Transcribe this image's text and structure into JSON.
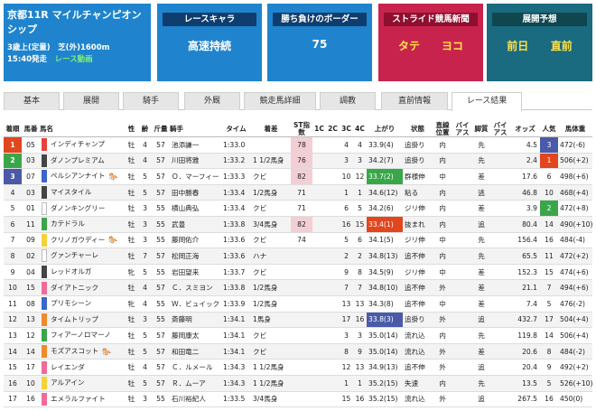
{
  "race": {
    "title": "京都11R マイルチャンピオンシップ",
    "conditions": "3歳上(定量)　芝(外)1600m",
    "post_time": "15:40発走",
    "video_link": "レース動画"
  },
  "cards": {
    "chara": {
      "title": "レースキャラ",
      "value": "高速持続"
    },
    "border": {
      "title": "勝ち負けのボーダー",
      "value": "75"
    },
    "shimbun": {
      "title": "ストライド競馬新聞",
      "left": "タテ",
      "right": "ヨコ"
    },
    "tenkai": {
      "title": "展開予想",
      "left": "前日",
      "right": "直前"
    }
  },
  "tabs": [
    "基本",
    "展開",
    "騎手",
    "外厩",
    "競走馬詳細",
    "調教",
    "直前情報",
    "レース結果"
  ],
  "active_tab": "レース結果",
  "headers": [
    "着順",
    "馬番",
    "馬名",
    "性",
    "齢",
    "斤量",
    "騎手",
    "タイム",
    "着差",
    "ST指数",
    "1C",
    "2C",
    "3C",
    "4C",
    "上がり",
    "状態",
    "直線位置",
    "バイアス",
    "脚質",
    "バイアス",
    "オッズ",
    "人気",
    "馬体重"
  ],
  "colors": {
    "gate_1": "#ffffff",
    "gate_2": "#444444",
    "gate_3": "#e8403a",
    "gate_4": "#3a67c8",
    "gate_5": "#f3d23a",
    "gate_6": "#3aa64a",
    "gate_7": "#f08a2a",
    "gate_8": "#f06a9a",
    "rank_1": "#e2461f",
    "rank_2": "#3aa64a",
    "rank_3": "#4a5aa8",
    "st_highlight": "#f3cfd5",
    "agari_1": "#e2461f",
    "agari_2": "#3aa64a",
    "agari_3": "#4a5aa8"
  },
  "rows": [
    {
      "rank": "1",
      "num": "05",
      "name": "インディチャンプ",
      "gate": 3,
      "flag": "",
      "sex": "牡",
      "age": "4",
      "kin": "57",
      "jockey": "池添謙一",
      "time": "1:33.0",
      "diff": "",
      "st": "78",
      "c1": "",
      "c2": "",
      "c3": "4",
      "c4": "4",
      "agari": "33.9(4)",
      "state": "追掛り",
      "pos": "内",
      "bias": "",
      "kyaku": "先",
      "bias2": "",
      "odds": "4.5",
      "ninki": "3",
      "weight": "472(-6)",
      "st_hl": true,
      "agari_rank": 0,
      "ninki_rank": 3
    },
    {
      "rank": "2",
      "num": "03",
      "name": "ダノンプレミアム",
      "gate": 2,
      "flag": "",
      "sex": "牡",
      "age": "4",
      "kin": "57",
      "jockey": "川田将雅",
      "time": "1:33.2",
      "diff": "1 1/2馬身",
      "st": "76",
      "c1": "",
      "c2": "",
      "c3": "3",
      "c4": "3",
      "agari": "34.2(7)",
      "state": "追掛り",
      "pos": "内",
      "bias": "",
      "kyaku": "先",
      "bias2": "",
      "odds": "2.4",
      "ninki": "1",
      "weight": "506(+2)",
      "st_hl": true,
      "agari_rank": 0,
      "ninki_rank": 1
    },
    {
      "rank": "3",
      "num": "07",
      "name": "ペルシアンナイト",
      "gate": 4,
      "flag": "🐎",
      "sex": "牡",
      "age": "5",
      "kin": "57",
      "jockey": "Ｏ．マーフィー",
      "time": "1:33.3",
      "diff": "クビ",
      "st": "82",
      "c1": "",
      "c2": "",
      "c3": "10",
      "c4": "12",
      "agari": "33.7(2)",
      "state": "群様伸",
      "pos": "中",
      "bias": "",
      "kyaku": "差",
      "bias2": "",
      "odds": "17.6",
      "ninki": "6",
      "weight": "498(+6)",
      "st_hl": true,
      "agari_rank": 2,
      "ninki_rank": 0
    },
    {
      "rank": "4",
      "num": "03",
      "name": "マイスタイル",
      "gate": 2,
      "flag": "",
      "sex": "牡",
      "age": "5",
      "kin": "57",
      "jockey": "田中勝春",
      "time": "1:33.4",
      "diff": "1/2馬身",
      "st": "71",
      "c1": "",
      "c2": "",
      "c3": "1",
      "c4": "1",
      "agari": "34.6(12)",
      "state": "粘る",
      "pos": "内",
      "bias": "",
      "kyaku": "逃",
      "bias2": "",
      "odds": "46.8",
      "ninki": "10",
      "weight": "468(+4)",
      "st_hl": false,
      "agari_rank": 0,
      "ninki_rank": 0
    },
    {
      "rank": "5",
      "num": "01",
      "name": "ダノンキングリー",
      "gate": 1,
      "flag": "",
      "sex": "牡",
      "age": "3",
      "kin": "55",
      "jockey": "横山典弘",
      "time": "1:33.4",
      "diff": "クビ",
      "st": "71",
      "c1": "",
      "c2": "",
      "c3": "6",
      "c4": "5",
      "agari": "34.2(6)",
      "state": "ジリ伸",
      "pos": "内",
      "bias": "",
      "kyaku": "差",
      "bias2": "",
      "odds": "3.9",
      "ninki": "2",
      "weight": "472(+8)",
      "st_hl": false,
      "agari_rank": 0,
      "ninki_rank": 2
    },
    {
      "rank": "6",
      "num": "11",
      "name": "カテドラル",
      "gate": 6,
      "flag": "",
      "sex": "牡",
      "age": "3",
      "kin": "55",
      "jockey": "武豊",
      "time": "1:33.8",
      "diff": "3/4馬身",
      "st": "82",
      "c1": "",
      "c2": "",
      "c3": "16",
      "c4": "15",
      "agari": "33.4(1)",
      "state": "抜まれ",
      "pos": "内",
      "bias": "",
      "kyaku": "追",
      "bias2": "",
      "odds": "80.4",
      "ninki": "14",
      "weight": "490(+10)",
      "st_hl": true,
      "agari_rank": 1,
      "ninki_rank": 0
    },
    {
      "rank": "7",
      "num": "09",
      "name": "クリノガウディー",
      "gate": 5,
      "flag": "🐎",
      "sex": "牡",
      "age": "3",
      "kin": "55",
      "jockey": "藤岡佑介",
      "time": "1:33.6",
      "diff": "クビ",
      "st": "74",
      "c1": "",
      "c2": "",
      "c3": "5",
      "c4": "6",
      "agari": "34.1(5)",
      "state": "ジリ伸",
      "pos": "中",
      "bias": "",
      "kyaku": "先",
      "bias2": "",
      "odds": "156.4",
      "ninki": "16",
      "weight": "484(-4)",
      "st_hl": false,
      "agari_rank": 0,
      "ninki_rank": 0
    },
    {
      "rank": "8",
      "num": "02",
      "name": "グァンチャーレ",
      "gate": 1,
      "flag": "",
      "sex": "牡",
      "age": "7",
      "kin": "57",
      "jockey": "松岡正海",
      "time": "1:33.6",
      "diff": "ハナ",
      "st": "",
      "c1": "",
      "c2": "",
      "c3": "2",
      "c4": "2",
      "agari": "34.8(13)",
      "state": "追不伸",
      "pos": "内",
      "bias": "",
      "kyaku": "先",
      "bias2": "",
      "odds": "65.5",
      "ninki": "11",
      "weight": "472(+2)",
      "st_hl": false,
      "agari_rank": 0,
      "ninki_rank": 0
    },
    {
      "rank": "9",
      "num": "04",
      "name": "レッドオルガ",
      "gate": 2,
      "flag": "",
      "sex": "牝",
      "age": "5",
      "kin": "55",
      "jockey": "岩田望来",
      "time": "1:33.7",
      "diff": "クビ",
      "st": "",
      "c1": "",
      "c2": "",
      "c3": "9",
      "c4": "8",
      "agari": "34.5(9)",
      "state": "ジリ伸",
      "pos": "中",
      "bias": "",
      "kyaku": "差",
      "bias2": "",
      "odds": "152.3",
      "ninki": "15",
      "weight": "474(+6)",
      "st_hl": false,
      "agari_rank": 0,
      "ninki_rank": 0
    },
    {
      "rank": "10",
      "num": "15",
      "name": "ダイアトニック",
      "gate": 8,
      "flag": "",
      "sex": "牡",
      "age": "4",
      "kin": "57",
      "jockey": "Ｃ．スミヨン",
      "time": "1:33.8",
      "diff": "1/2馬身",
      "st": "",
      "c1": "",
      "c2": "",
      "c3": "7",
      "c4": "7",
      "agari": "34.8(10)",
      "state": "追不伸",
      "pos": "外",
      "bias": "",
      "kyaku": "差",
      "bias2": "",
      "odds": "21.1",
      "ninki": "7",
      "weight": "494(+6)",
      "st_hl": false,
      "agari_rank": 0,
      "ninki_rank": 0
    },
    {
      "rank": "11",
      "num": "08",
      "name": "プリモシーン",
      "gate": 4,
      "flag": "",
      "sex": "牝",
      "age": "4",
      "kin": "55",
      "jockey": "Ｗ．ビュイック",
      "time": "1:33.9",
      "diff": "1/2馬身",
      "st": "",
      "c1": "",
      "c2": "",
      "c3": "13",
      "c4": "13",
      "agari": "34.3(8)",
      "state": "追不伸",
      "pos": "中",
      "bias": "",
      "kyaku": "差",
      "bias2": "",
      "odds": "7.4",
      "ninki": "5",
      "weight": "476(-2)",
      "st_hl": false,
      "agari_rank": 0,
      "ninki_rank": 0
    },
    {
      "rank": "12",
      "num": "13",
      "name": "タイムトリップ",
      "gate": 7,
      "flag": "",
      "sex": "牡",
      "age": "3",
      "kin": "55",
      "jockey": "斎藤明",
      "time": "1:34.1",
      "diff": "1馬身",
      "st": "",
      "c1": "",
      "c2": "",
      "c3": "17",
      "c4": "16",
      "agari": "33.8(3)",
      "state": "追掛り",
      "pos": "外",
      "bias": "",
      "kyaku": "追",
      "bias2": "",
      "odds": "432.7",
      "ninki": "17",
      "weight": "504(+4)",
      "st_hl": false,
      "agari_rank": 3,
      "ninki_rank": 0
    },
    {
      "rank": "13",
      "num": "12",
      "name": "フィアーノロマーノ",
      "gate": 6,
      "flag": "",
      "sex": "牡",
      "age": "5",
      "kin": "57",
      "jockey": "藤岡康太",
      "time": "1:34.1",
      "diff": "クビ",
      "st": "",
      "c1": "",
      "c2": "",
      "c3": "3",
      "c4": "3",
      "agari": "35.0(14)",
      "state": "流れ込",
      "pos": "内",
      "bias": "",
      "kyaku": "先",
      "bias2": "",
      "odds": "119.8",
      "ninki": "14",
      "weight": "506(+4)",
      "st_hl": false,
      "agari_rank": 0,
      "ninki_rank": 0
    },
    {
      "rank": "14",
      "num": "14",
      "name": "モズアスコット",
      "gate": 7,
      "flag": "🐎",
      "sex": "牡",
      "age": "5",
      "kin": "57",
      "jockey": "和田竜二",
      "time": "1:34.1",
      "diff": "クビ",
      "st": "",
      "c1": "",
      "c2": "",
      "c3": "8",
      "c4": "9",
      "agari": "35.0(14)",
      "state": "流れ込",
      "pos": "外",
      "bias": "",
      "kyaku": "差",
      "bias2": "",
      "odds": "20.6",
      "ninki": "8",
      "weight": "484(-2)",
      "st_hl": false,
      "agari_rank": 0,
      "ninki_rank": 0
    },
    {
      "rank": "15",
      "num": "17",
      "name": "レイエンダ",
      "gate": 8,
      "flag": "",
      "sex": "牡",
      "age": "4",
      "kin": "57",
      "jockey": "Ｃ．ルメール",
      "time": "1:34.3",
      "diff": "1 1/2馬身",
      "st": "",
      "c1": "",
      "c2": "",
      "c3": "12",
      "c4": "13",
      "agari": "34.9(13)",
      "state": "追不伸",
      "pos": "外",
      "bias": "",
      "kyaku": "追",
      "bias2": "",
      "odds": "20.4",
      "ninki": "9",
      "weight": "492(+2)",
      "st_hl": false,
      "agari_rank": 0,
      "ninki_rank": 0
    },
    {
      "rank": "16",
      "num": "10",
      "name": "アルアイン",
      "gate": 5,
      "flag": "",
      "sex": "牡",
      "age": "5",
      "kin": "57",
      "jockey": "Ｒ．ムーア",
      "time": "1:34.3",
      "diff": "1 1/2馬身",
      "st": "",
      "c1": "",
      "c2": "",
      "c3": "1",
      "c4": "1",
      "agari": "35.2(15)",
      "state": "失速",
      "pos": "内",
      "bias": "",
      "kyaku": "先",
      "bias2": "",
      "odds": "13.5",
      "ninki": "5",
      "weight": "526(+10)",
      "st_hl": false,
      "agari_rank": 0,
      "ninki_rank": 0
    },
    {
      "rank": "17",
      "num": "16",
      "name": "エメラルファイト",
      "gate": 8,
      "flag": "",
      "sex": "牡",
      "age": "3",
      "kin": "55",
      "jockey": "石川裕紀人",
      "time": "1:33.5",
      "diff": "3/4馬身",
      "st": "",
      "c1": "",
      "c2": "",
      "c3": "15",
      "c4": "16",
      "agari": "35.2(15)",
      "state": "流れ込",
      "pos": "外",
      "bias": "",
      "kyaku": "追",
      "bias2": "",
      "odds": "267.5",
      "ninki": "16",
      "weight": "450(0)",
      "st_hl": false,
      "agari_rank": 0,
      "ninki_rank": 0
    }
  ]
}
